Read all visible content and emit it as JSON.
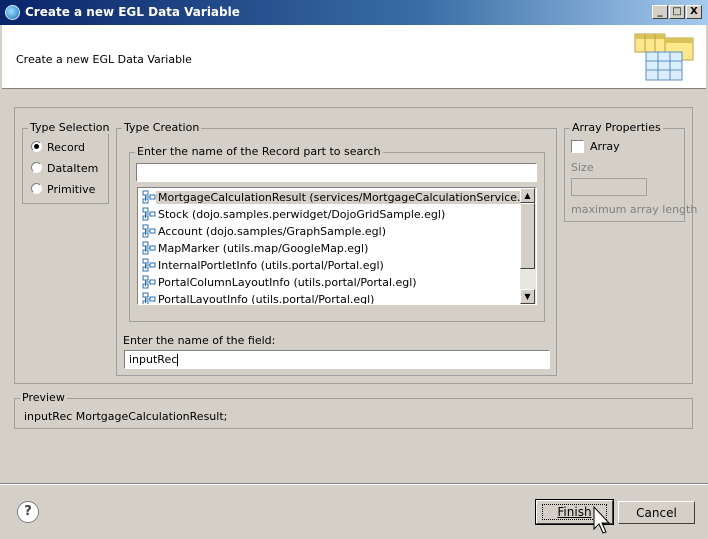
{
  "window": {
    "title": "Create a new EGL Data Variable",
    "controls": {
      "minimize": "_",
      "maximize": "□",
      "close": "X"
    }
  },
  "header": {
    "description": "Create a new EGL Data Variable"
  },
  "type_selection": {
    "label": "Type Selection",
    "options": [
      {
        "label": "Record",
        "checked": true
      },
      {
        "label": "DataItem",
        "checked": false
      },
      {
        "label": "Primitive",
        "checked": false
      }
    ]
  },
  "type_creation": {
    "label": "Type Creation",
    "search_group_label": "Enter the name of the Record part to search",
    "search_value": "",
    "records": [
      {
        "label": "MortgageCalculationResult (services/MortgageCalculationService.egl)",
        "selected": true
      },
      {
        "label": "Stock (dojo.samples.perwidget/DojoGridSample.egl)",
        "selected": false
      },
      {
        "label": "Account (dojo.samples/GraphSample.egl)",
        "selected": false
      },
      {
        "label": "MapMarker (utils.map/GoogleMap.egl)",
        "selected": false
      },
      {
        "label": "InternalPortletInfo (utils.portal/Portal.egl)",
        "selected": false
      },
      {
        "label": "PortalColumnLayoutInfo (utils.portal/Portal.egl)",
        "selected": false
      },
      {
        "label": "PortalLayoutInfo (utils.portal/Portal.egl)",
        "selected": false
      }
    ],
    "field_label": "Enter the name of the field:",
    "field_value": "inputRec"
  },
  "array_properties": {
    "label": "Array Properties",
    "array_label": "Array",
    "array_checked": false,
    "size_label": "Size",
    "size_value": "",
    "max_length_label": "maximum array length"
  },
  "preview": {
    "label": "Preview",
    "text": "inputRec MortgageCalculationResult;"
  },
  "footer": {
    "help_symbol": "?",
    "finish_label": "Finish",
    "cancel_label": "Cancel"
  },
  "colors": {
    "titlebar_start": "#0a246a",
    "titlebar_end": "#a6caf0",
    "dialog_bg": "#d4d0c8"
  }
}
